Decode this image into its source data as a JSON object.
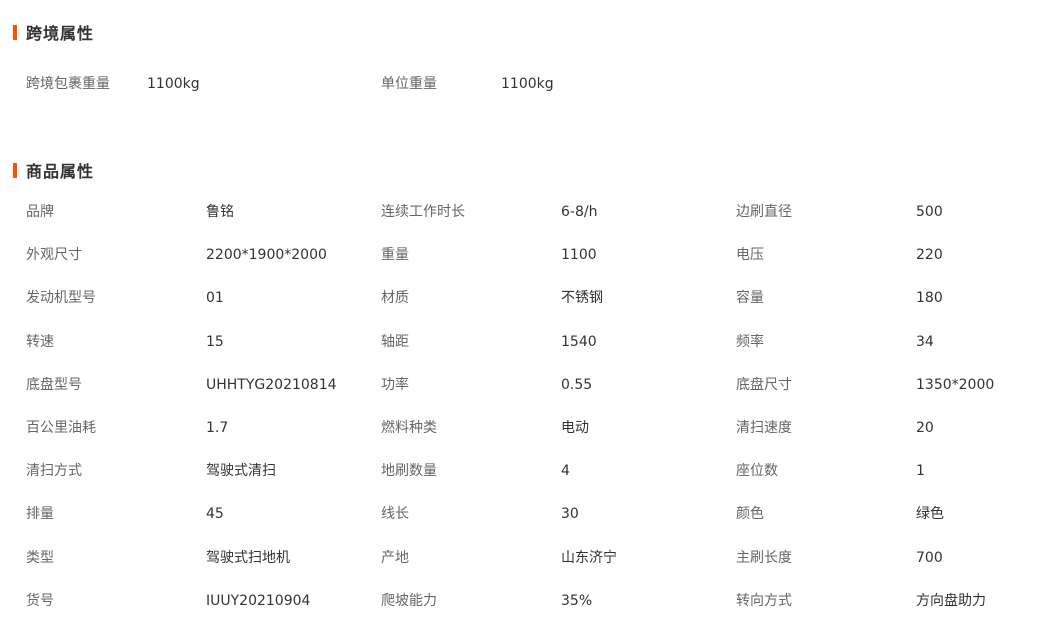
{
  "colors": {
    "accent": "#ff5000",
    "label_text": "#666666",
    "value_text": "#333333"
  },
  "cross_border": {
    "title": "跨境属性",
    "items": [
      {
        "label": "跨境包裹重量",
        "value": "1100kg"
      },
      {
        "label": "单位重量",
        "value": "1100kg"
      }
    ]
  },
  "product": {
    "title": "商品属性",
    "rows": [
      [
        {
          "label": "品牌",
          "value": "鲁铭"
        },
        {
          "label": "连续工作时长",
          "value": "6-8/h"
        },
        {
          "label": "边刷直径",
          "value": "500"
        }
      ],
      [
        {
          "label": "外观尺寸",
          "value": "2200*1900*2000"
        },
        {
          "label": "重量",
          "value": "1100"
        },
        {
          "label": "电压",
          "value": "220"
        }
      ],
      [
        {
          "label": "发动机型号",
          "value": "01"
        },
        {
          "label": "材质",
          "value": "不锈钢"
        },
        {
          "label": "容量",
          "value": "180"
        }
      ],
      [
        {
          "label": "转速",
          "value": "15"
        },
        {
          "label": "轴距",
          "value": "1540"
        },
        {
          "label": "频率",
          "value": "34"
        }
      ],
      [
        {
          "label": "底盘型号",
          "value": "UHHTYG20210814"
        },
        {
          "label": "功率",
          "value": "0.55"
        },
        {
          "label": "底盘尺寸",
          "value": "1350*2000"
        }
      ],
      [
        {
          "label": "百公里油耗",
          "value": "1.7"
        },
        {
          "label": "燃料种类",
          "value": "电动"
        },
        {
          "label": "清扫速度",
          "value": "20"
        }
      ],
      [
        {
          "label": "清扫方式",
          "value": "驾驶式清扫"
        },
        {
          "label": "地刷数量",
          "value": "4"
        },
        {
          "label": "座位数",
          "value": "1"
        }
      ],
      [
        {
          "label": "排量",
          "value": "45"
        },
        {
          "label": "线长",
          "value": "30"
        },
        {
          "label": "颜色",
          "value": "绿色"
        }
      ],
      [
        {
          "label": "类型",
          "value": "驾驶式扫地机"
        },
        {
          "label": "产地",
          "value": "山东济宁"
        },
        {
          "label": "主刷长度",
          "value": "700"
        }
      ],
      [
        {
          "label": "货号",
          "value": "IUUY20210904"
        },
        {
          "label": "爬坡能力",
          "value": "35%"
        },
        {
          "label": "转向方式",
          "value": "方向盘助力"
        }
      ]
    ]
  }
}
